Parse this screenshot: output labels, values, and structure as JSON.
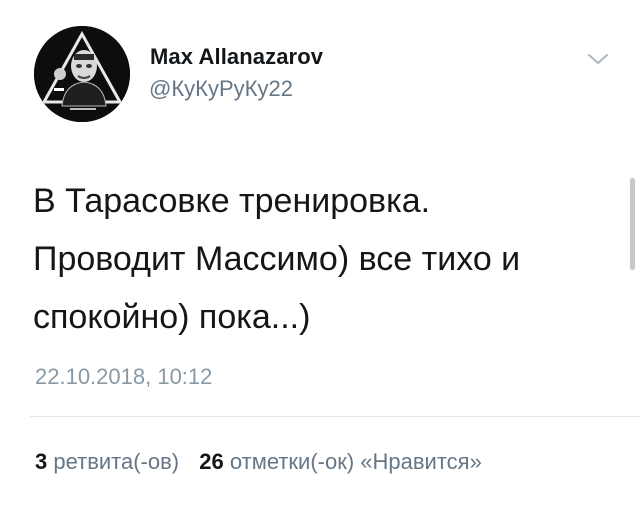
{
  "user": {
    "display_name": "Max Allanazarov",
    "handle": "@КуКуРуКу22"
  },
  "tweet": {
    "text": "В Тарасовке тренировка.\nПроводит Массимо) все тихо и\nспокойно) пока...)",
    "timestamp": "22.10.2018, 10:12"
  },
  "stats": {
    "retweets_count": "3",
    "retweets_label": "ретвита(-ов)",
    "likes_count": "26",
    "likes_label": "отметки(-ок) «Нравится»"
  },
  "icons": {
    "caret": "chevron-down-icon",
    "avatar": "avatar"
  },
  "colors": {
    "name": "#14171a",
    "secondary": "#657786",
    "timestamp": "#8899a6",
    "divider": "#e1e8ed"
  }
}
